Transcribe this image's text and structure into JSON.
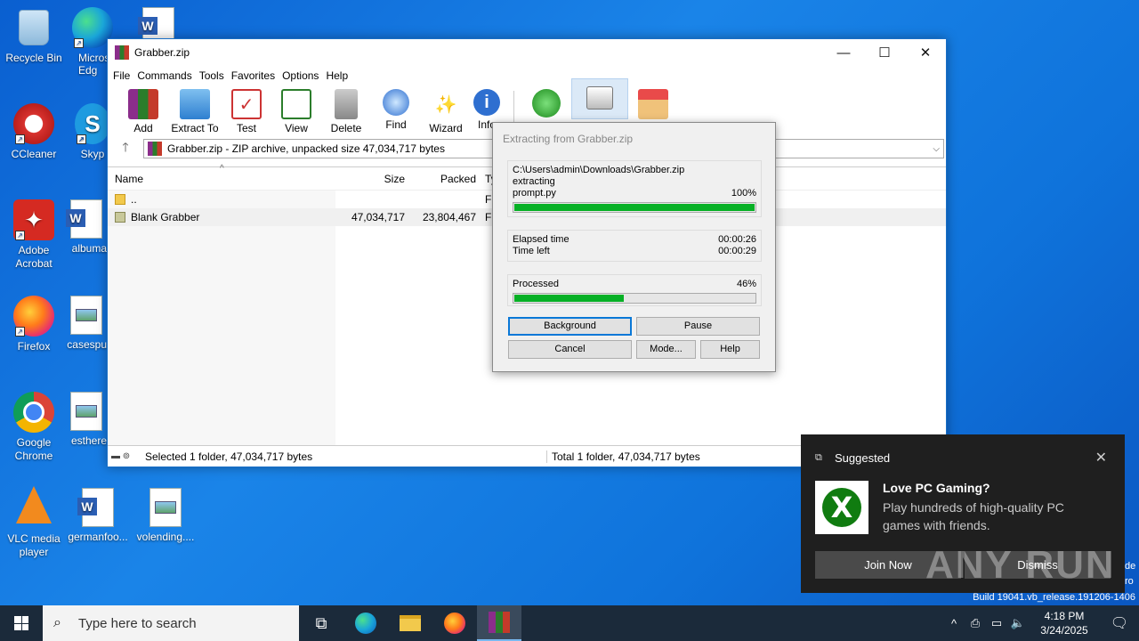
{
  "desktop": {
    "icons": [
      {
        "label": "Recycle Bin"
      },
      {
        "label": "Micros\nEdg"
      },
      {
        "label": ""
      },
      {
        "label": "CCleaner"
      },
      {
        "label": "Skyp"
      },
      {
        "label": "Adobe Acrobat"
      },
      {
        "label": "albuma"
      },
      {
        "label": "Firefox"
      },
      {
        "label": "casespu"
      },
      {
        "label": "Google Chrome"
      },
      {
        "label": "esthere"
      },
      {
        "label": "VLC media player"
      },
      {
        "label": "germanfoo..."
      },
      {
        "label": "volending...."
      }
    ]
  },
  "window": {
    "title": "Grabber.zip",
    "menu": [
      "File",
      "Commands",
      "Tools",
      "Favorites",
      "Options",
      "Help"
    ],
    "toolbar": [
      "Add",
      "Extract To",
      "Test",
      "View",
      "Delete",
      "Find",
      "Wizard",
      "Info",
      "",
      "",
      ""
    ],
    "address": "Grabber.zip - ZIP archive, unpacked size 47,034,717 bytes",
    "columns": {
      "name": "Name",
      "size": "Size",
      "packed": "Packed",
      "type": "Ty"
    },
    "rows": [
      {
        "name": "..",
        "size": "",
        "packed": "",
        "type": "Fi"
      },
      {
        "name": "Blank Grabber",
        "size": "47,034,717",
        "packed": "23,804,467",
        "type": "Fi"
      }
    ],
    "status_left": "Selected 1 folder, 47,034,717 bytes",
    "status_right": "Total 1 folder, 47,034,717 bytes"
  },
  "dialog": {
    "title": "Extracting from Grabber.zip",
    "path": "C:\\Users\\admin\\Downloads\\Grabber.zip",
    "action": "extracting",
    "file": "prompt.py",
    "file_percent": "100%",
    "file_progress": 1.0,
    "elapsed_label": "Elapsed time",
    "elapsed": "00:00:26",
    "left_label": "Time left",
    "left": "00:00:29",
    "processed_label": "Processed",
    "processed_percent": "46%",
    "processed_progress": 0.46,
    "buttons": {
      "background": "Background",
      "pause": "Pause",
      "cancel": "Cancel",
      "mode": "Mode...",
      "help": "Help"
    }
  },
  "toast": {
    "header": "Suggested",
    "title": "Love PC Gaming?",
    "message": "Play hundreds of high-quality PC games with friends.",
    "join": "Join Now",
    "dismiss": "Dismiss"
  },
  "watermark": "ANY RUN",
  "build": "Build 19041.vb_release.191206-1406",
  "edge_text": [
    "de",
    "ro"
  ],
  "taskbar": {
    "search_placeholder": "Type here to search",
    "time": "4:18 PM",
    "date": "3/24/2025"
  }
}
